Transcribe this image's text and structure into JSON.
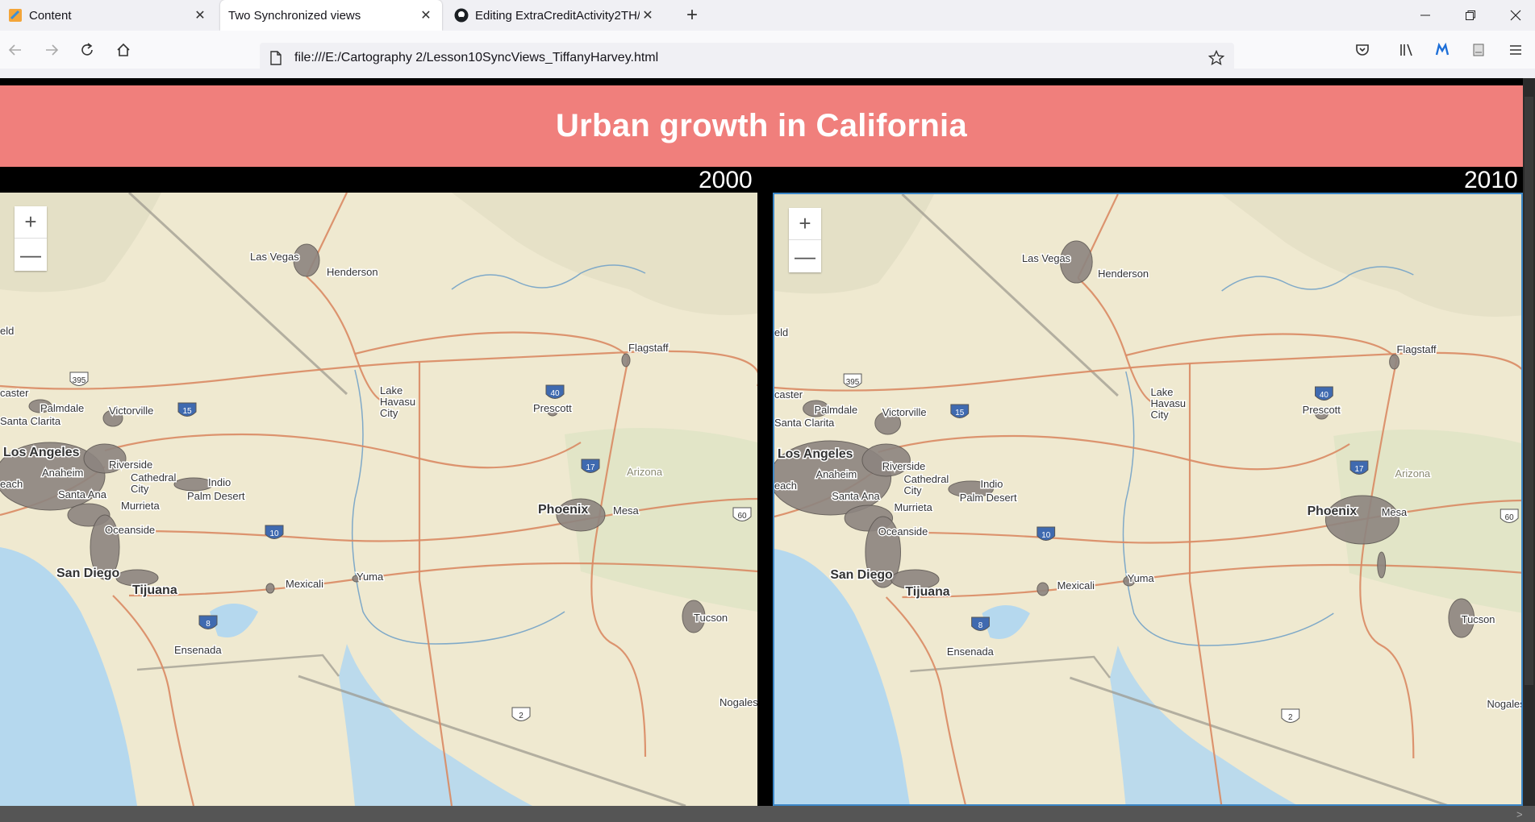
{
  "tabs": [
    {
      "label": "Content",
      "icon": "generic-page-icon"
    },
    {
      "label": "Two Synchronized views",
      "icon": null,
      "active": true
    },
    {
      "label": "Editing ExtraCreditActivity2TH/",
      "icon": "github-icon"
    }
  ],
  "url": "file:///E:/Cartography 2/Lesson10SyncViews_TiffanyHarvey.html",
  "page": {
    "title": "Urban growth in California",
    "years": [
      "2000",
      "2010"
    ]
  },
  "map": {
    "places": [
      "Las Vegas",
      "Henderson",
      "Flagstaff",
      "Lake Havasu City",
      "Prescott",
      "Palmdale",
      "Victorville",
      "Santa Clarita",
      "Los Angeles",
      "Anaheim",
      "Riverside",
      "Cathedral City",
      "Indio",
      "Palm Desert",
      "Santa Ana",
      "Murrieta",
      "Oceanside",
      "San Diego",
      "Tijuana",
      "Mexicali",
      "Yuma",
      "Phoenix",
      "Mesa",
      "Arizona",
      "Tucson",
      "Ensenada",
      "Nogales",
      "caster",
      "eld",
      "each"
    ],
    "highways": [
      "15",
      "395",
      "40",
      "17",
      "10",
      "8",
      "60",
      "2"
    ]
  },
  "colors": {
    "banner": "#f07f7c",
    "urban": "#8d8580",
    "land": "#efe9d0",
    "water": "#b5d8ee"
  }
}
